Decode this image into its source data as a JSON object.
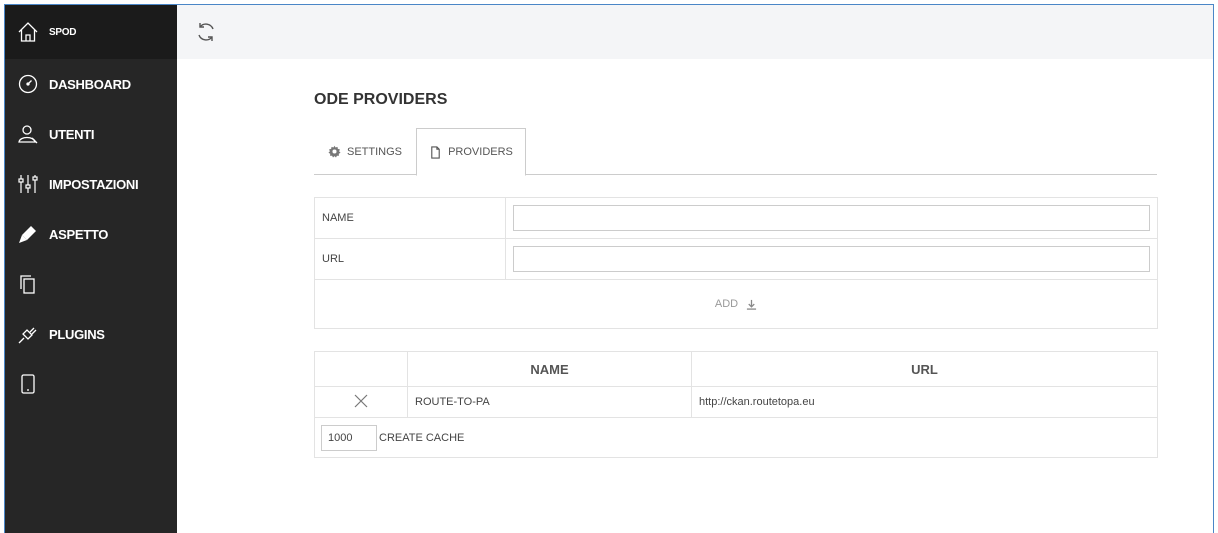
{
  "sidebar": {
    "brand": {
      "label": "SPOD",
      "icon": "home-icon"
    },
    "items": [
      {
        "label": "DASHBOARD",
        "icon": "gauge-icon"
      },
      {
        "label": "UTENTI",
        "icon": "user-icon"
      },
      {
        "label": "IMPOSTAZIONI",
        "icon": "sliders-icon"
      },
      {
        "label": "ASPETTO",
        "icon": "brush-icon"
      },
      {
        "label": "",
        "icon": "copy-icon"
      },
      {
        "label": "PLUGINS",
        "icon": "plug-icon"
      },
      {
        "label": "",
        "icon": "mobile-icon"
      }
    ]
  },
  "topbar": {
    "icon": "refresh-icon"
  },
  "page": {
    "title": "ODE PROVIDERS",
    "tabs": [
      {
        "label": "SETTINGS",
        "icon": "gear-icon",
        "active": false
      },
      {
        "label": "PROVIDERS",
        "icon": "file-icon",
        "active": true
      }
    ]
  },
  "form": {
    "name_label": "NAME",
    "name_value": "",
    "url_label": "URL",
    "url_value": "",
    "add_label": "ADD",
    "add_icon": "download-icon"
  },
  "table": {
    "headers": [
      "",
      "NAME",
      "URL"
    ],
    "rows": [
      {
        "delete_icon": "close-icon",
        "name": "ROUTE-TO-PA",
        "url": "http://ckan.routetopa.eu"
      }
    ],
    "cache_value": "1000",
    "cache_label": "CREATE CACHE"
  },
  "colors": {
    "sidebar_bg": "#262626",
    "brand_bg": "#1b1b1b",
    "topbar_bg": "#f4f5f7",
    "frame_border": "#4a86c7"
  }
}
